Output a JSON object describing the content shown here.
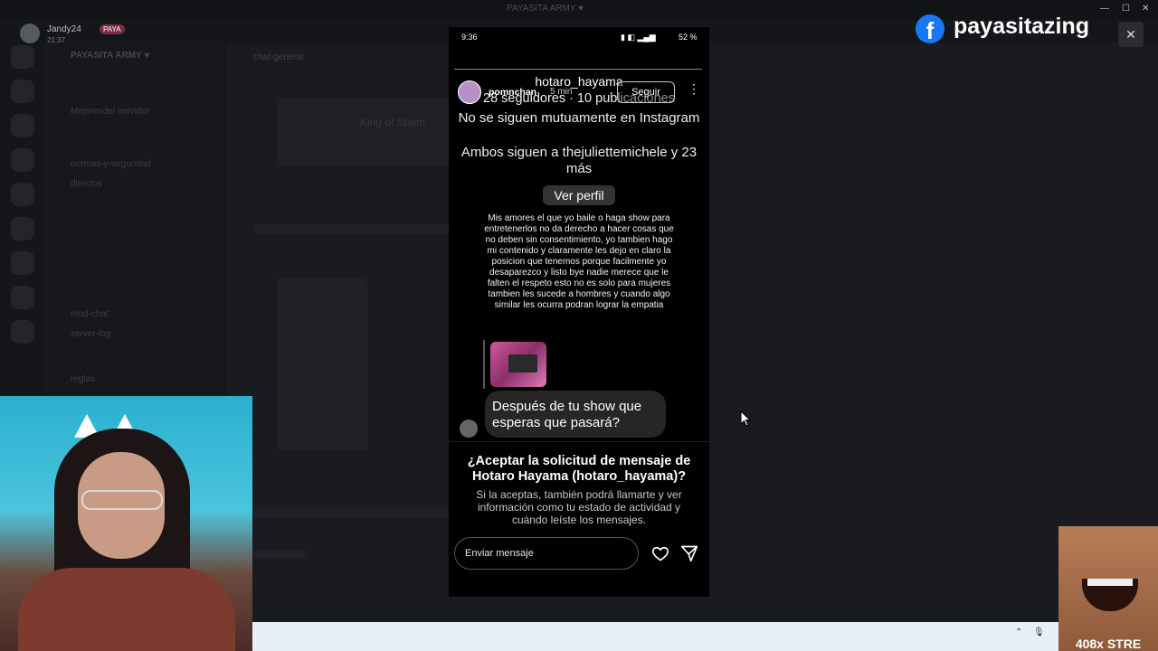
{
  "discord": {
    "window_title": "PAYASITA ARMY ♥",
    "server_name": "PAYASITA ARMY ♥",
    "channel_header": "chat-general",
    "channels": [
      "Mejoresdel servidor",
      "normas-y-seguridad",
      "directos",
      "mod-chat",
      "server-log",
      "reglas"
    ],
    "king_label": "King of Spam"
  },
  "user": {
    "name": "Jandy24",
    "badge": "PAYA",
    "time": "21:37"
  },
  "phone": {
    "status_time": "9:36",
    "status_battery": "52 %",
    "profile_name": "hotaro_hayama",
    "profile_stats": "28 seguidores · 10 publicaciones",
    "story_user": "pomnchan",
    "story_time": "5 min",
    "follow_label": "Seguir",
    "mutual_text": "No se siguen mutuamente en Instagram",
    "both_follow_text": "Ambos siguen a thejuliettemichele y 23 más",
    "view_profile_label": "Ver perfil",
    "story_text": "Mis amores el que yo baile o haga show para entretenerlos no da derecho a hacer cosas que no deben sin consentimiento, yo tambien hago mi contenido y claramente les dejo en claro la posicion que tenemos porque facilmente yo desaparezco y listo bye nadie merece que le falten el respeto esto no es solo para mujeres tambien les sucede a hombres y cuando algo similar les ocurra podran lograr la empatia",
    "message_text": "Después de tu show que esperas que pasará?",
    "accept_question": "¿Aceptar la solicitud de mensaje de Hotaro Hayama (hotaro_hayama)?",
    "accept_info": "Si la aceptas, también podrá llamarte y ver información como tu estado de actividad y cuándo leíste los mensajes.",
    "input_placeholder": "Enviar mensaje"
  },
  "overlay": {
    "fb_name": "payasitazing",
    "close": "✕",
    "meme_text": "408x STRE"
  },
  "colors": {
    "facebook": "#1877f2",
    "phone_bg": "#000000",
    "bubble": "#262626"
  }
}
